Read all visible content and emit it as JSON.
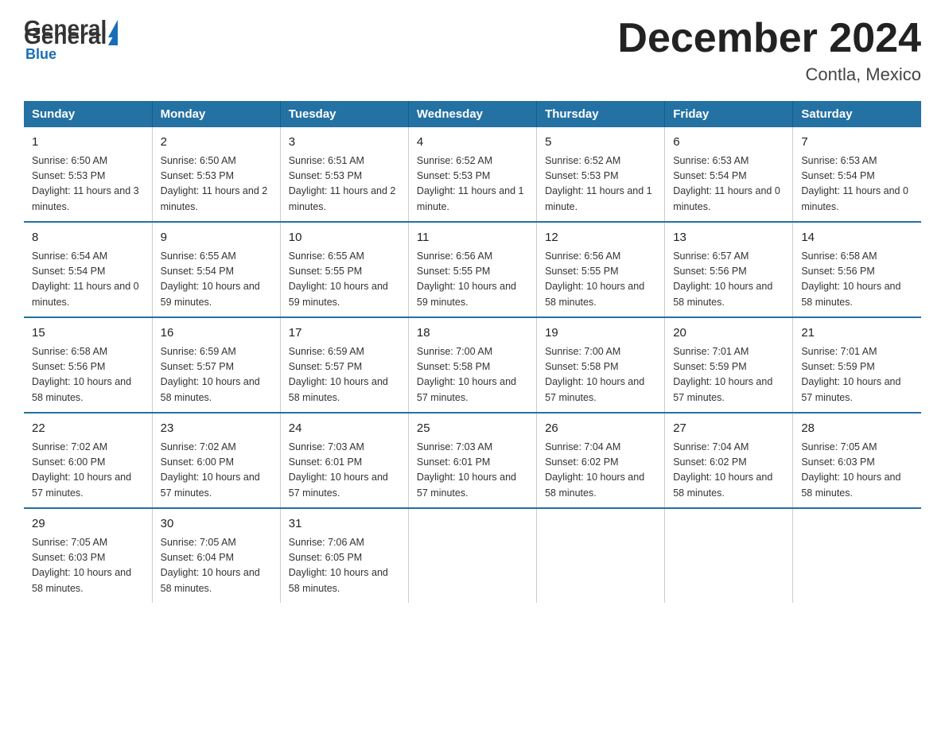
{
  "header": {
    "logo_general": "General",
    "logo_blue": "Blue",
    "month_title": "December 2024",
    "location": "Contla, Mexico"
  },
  "days_of_week": [
    "Sunday",
    "Monday",
    "Tuesday",
    "Wednesday",
    "Thursday",
    "Friday",
    "Saturday"
  ],
  "weeks": [
    [
      {
        "day": "1",
        "sunrise": "6:50 AM",
        "sunset": "5:53 PM",
        "daylight": "11 hours and 3 minutes."
      },
      {
        "day": "2",
        "sunrise": "6:50 AM",
        "sunset": "5:53 PM",
        "daylight": "11 hours and 2 minutes."
      },
      {
        "day": "3",
        "sunrise": "6:51 AM",
        "sunset": "5:53 PM",
        "daylight": "11 hours and 2 minutes."
      },
      {
        "day": "4",
        "sunrise": "6:52 AM",
        "sunset": "5:53 PM",
        "daylight": "11 hours and 1 minute."
      },
      {
        "day": "5",
        "sunrise": "6:52 AM",
        "sunset": "5:53 PM",
        "daylight": "11 hours and 1 minute."
      },
      {
        "day": "6",
        "sunrise": "6:53 AM",
        "sunset": "5:54 PM",
        "daylight": "11 hours and 0 minutes."
      },
      {
        "day": "7",
        "sunrise": "6:53 AM",
        "sunset": "5:54 PM",
        "daylight": "11 hours and 0 minutes."
      }
    ],
    [
      {
        "day": "8",
        "sunrise": "6:54 AM",
        "sunset": "5:54 PM",
        "daylight": "11 hours and 0 minutes."
      },
      {
        "day": "9",
        "sunrise": "6:55 AM",
        "sunset": "5:54 PM",
        "daylight": "10 hours and 59 minutes."
      },
      {
        "day": "10",
        "sunrise": "6:55 AM",
        "sunset": "5:55 PM",
        "daylight": "10 hours and 59 minutes."
      },
      {
        "day": "11",
        "sunrise": "6:56 AM",
        "sunset": "5:55 PM",
        "daylight": "10 hours and 59 minutes."
      },
      {
        "day": "12",
        "sunrise": "6:56 AM",
        "sunset": "5:55 PM",
        "daylight": "10 hours and 58 minutes."
      },
      {
        "day": "13",
        "sunrise": "6:57 AM",
        "sunset": "5:56 PM",
        "daylight": "10 hours and 58 minutes."
      },
      {
        "day": "14",
        "sunrise": "6:58 AM",
        "sunset": "5:56 PM",
        "daylight": "10 hours and 58 minutes."
      }
    ],
    [
      {
        "day": "15",
        "sunrise": "6:58 AM",
        "sunset": "5:56 PM",
        "daylight": "10 hours and 58 minutes."
      },
      {
        "day": "16",
        "sunrise": "6:59 AM",
        "sunset": "5:57 PM",
        "daylight": "10 hours and 58 minutes."
      },
      {
        "day": "17",
        "sunrise": "6:59 AM",
        "sunset": "5:57 PM",
        "daylight": "10 hours and 58 minutes."
      },
      {
        "day": "18",
        "sunrise": "7:00 AM",
        "sunset": "5:58 PM",
        "daylight": "10 hours and 57 minutes."
      },
      {
        "day": "19",
        "sunrise": "7:00 AM",
        "sunset": "5:58 PM",
        "daylight": "10 hours and 57 minutes."
      },
      {
        "day": "20",
        "sunrise": "7:01 AM",
        "sunset": "5:59 PM",
        "daylight": "10 hours and 57 minutes."
      },
      {
        "day": "21",
        "sunrise": "7:01 AM",
        "sunset": "5:59 PM",
        "daylight": "10 hours and 57 minutes."
      }
    ],
    [
      {
        "day": "22",
        "sunrise": "7:02 AM",
        "sunset": "6:00 PM",
        "daylight": "10 hours and 57 minutes."
      },
      {
        "day": "23",
        "sunrise": "7:02 AM",
        "sunset": "6:00 PM",
        "daylight": "10 hours and 57 minutes."
      },
      {
        "day": "24",
        "sunrise": "7:03 AM",
        "sunset": "6:01 PM",
        "daylight": "10 hours and 57 minutes."
      },
      {
        "day": "25",
        "sunrise": "7:03 AM",
        "sunset": "6:01 PM",
        "daylight": "10 hours and 57 minutes."
      },
      {
        "day": "26",
        "sunrise": "7:04 AM",
        "sunset": "6:02 PM",
        "daylight": "10 hours and 58 minutes."
      },
      {
        "day": "27",
        "sunrise": "7:04 AM",
        "sunset": "6:02 PM",
        "daylight": "10 hours and 58 minutes."
      },
      {
        "day": "28",
        "sunrise": "7:05 AM",
        "sunset": "6:03 PM",
        "daylight": "10 hours and 58 minutes."
      }
    ],
    [
      {
        "day": "29",
        "sunrise": "7:05 AM",
        "sunset": "6:03 PM",
        "daylight": "10 hours and 58 minutes."
      },
      {
        "day": "30",
        "sunrise": "7:05 AM",
        "sunset": "6:04 PM",
        "daylight": "10 hours and 58 minutes."
      },
      {
        "day": "31",
        "sunrise": "7:06 AM",
        "sunset": "6:05 PM",
        "daylight": "10 hours and 58 minutes."
      },
      null,
      null,
      null,
      null
    ]
  ],
  "labels": {
    "sunrise": "Sunrise:",
    "sunset": "Sunset:",
    "daylight": "Daylight:"
  }
}
